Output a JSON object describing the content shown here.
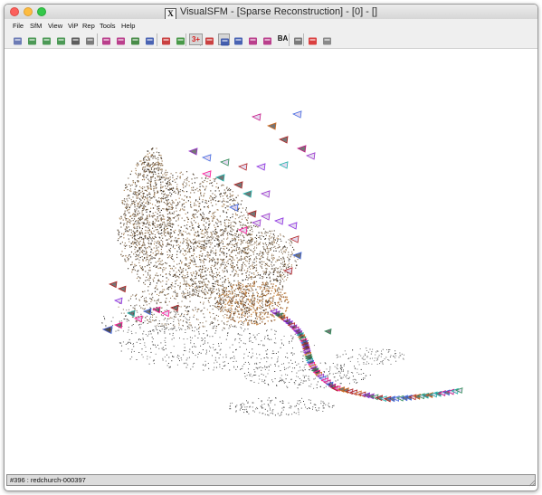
{
  "window": {
    "title": "VisualSFM - [Sparse Reconstruction] - [0] - []",
    "x11_glyph": "X"
  },
  "menu": [
    {
      "label": "File"
    },
    {
      "label": "SfM"
    },
    {
      "label": "View"
    },
    {
      "label": "ViP"
    },
    {
      "label": "Rep"
    },
    {
      "label": "Tools"
    },
    {
      "label": "Help"
    }
  ],
  "toolbar": {
    "buttons": [
      {
        "name": "new-log-icon",
        "color": "#5566aa"
      },
      {
        "name": "open-single-images-icon",
        "color": "#2f8a3b"
      },
      {
        "name": "open-multiple-images-icon",
        "color": "#2f8a3b"
      },
      {
        "name": "open-nvm-icon",
        "color": "#2f8a3b"
      },
      {
        "name": "save-nvm-icon",
        "color": "#444444"
      },
      {
        "name": "list-icon",
        "color": "#666666"
      },
      {
        "name": "show-thumbnails-icon",
        "color": "#b0207a"
      },
      {
        "name": "feature-matches-icon",
        "color": "#b0207a"
      },
      {
        "name": "match-matrix-icon",
        "color": "#2b7a2b"
      },
      {
        "name": "compute-missing-match-icon",
        "color": "#2b4aa8"
      },
      {
        "name": "pick-point-icon",
        "color": "#c32222"
      },
      {
        "name": "lock-icon",
        "color": "#2b8a2b"
      },
      {
        "name": "toggle-3d-icon",
        "color": "#d62020",
        "text": "3+"
      },
      {
        "name": "compute-sparse-icon",
        "color": "#c32222"
      },
      {
        "name": "run-sfm-icon",
        "color": "#2b4aa8"
      },
      {
        "name": "grid-view-icon",
        "color": "#2b4aa8"
      },
      {
        "name": "next-step-icon",
        "color": "#b0207a"
      },
      {
        "name": "dense-icon",
        "color": "#b0207a"
      },
      {
        "name": "bundle-adjust-icon",
        "color": "#111111",
        "text": "BA"
      },
      {
        "name": "gear-icon",
        "color": "#666666"
      },
      {
        "name": "pause-icon",
        "color": "#d62020"
      },
      {
        "name": "pan-hand-icon",
        "color": "#777777"
      }
    ]
  },
  "status": {
    "text": "#396 : redchurch-000397"
  },
  "colors": {
    "accent_red": "#fc605c",
    "accent_yellow": "#fdbc40",
    "accent_green": "#34c84a"
  }
}
